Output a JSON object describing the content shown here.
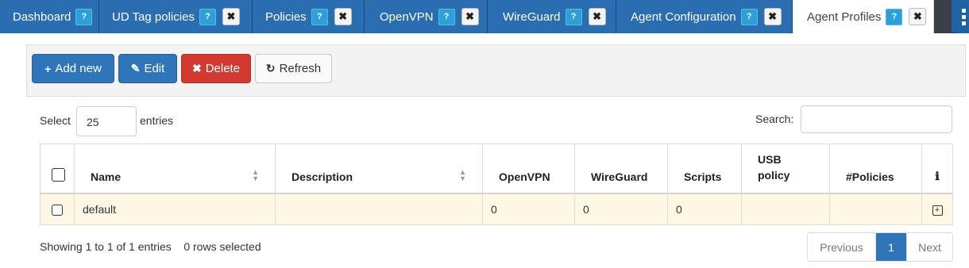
{
  "tabs": [
    {
      "label": "Dashboard",
      "help": "?",
      "close": null,
      "active": false
    },
    {
      "label": "UD Tag policies",
      "help": "?",
      "close": "✖",
      "active": false
    },
    {
      "label": "Policies",
      "help": "?",
      "close": "✖",
      "active": false
    },
    {
      "label": "OpenVPN",
      "help": "?",
      "close": "✖",
      "active": false
    },
    {
      "label": "WireGuard",
      "help": "?",
      "close": "✖",
      "active": false
    },
    {
      "label": "Agent Configuration",
      "help": "?",
      "close": "✖",
      "active": false
    },
    {
      "label": "Agent Profiles",
      "help": "?",
      "close": "✖",
      "active": true
    }
  ],
  "toolbar": {
    "add_label": "Add new",
    "edit_label": "Edit",
    "delete_label": "Delete",
    "refresh_label": "Refresh",
    "add_icon": "plus-icon",
    "edit_icon": "pencil-icon",
    "delete_icon": "times-icon",
    "refresh_icon": "refresh-icon"
  },
  "length": {
    "prefix": "Select",
    "value": "25",
    "suffix": "entries"
  },
  "search": {
    "label": "Search:",
    "value": ""
  },
  "table": {
    "columns": {
      "name": "Name",
      "description": "Description",
      "openvpn": "OpenVPN",
      "wireguard": "WireGuard",
      "scripts": "Scripts",
      "usb_line1": "USB",
      "usb_line2": "policy",
      "policies": "#Policies",
      "info": "ℹ"
    },
    "rows": [
      {
        "name": "default",
        "description": "",
        "openvpn": "0",
        "wireguard": "0",
        "scripts": "0",
        "usb_policy": "",
        "policies": ""
      }
    ]
  },
  "footer": {
    "info": "Showing 1 to 1 of 1 entries    0 rows selected"
  },
  "pagination": {
    "previous": "Previous",
    "page": "1",
    "next": "Next"
  },
  "colors": {
    "accent": "#2f75b9",
    "danger": "#d23a31",
    "tabbar": "#1f63a6",
    "row_highlight": "#fcf8e3"
  }
}
